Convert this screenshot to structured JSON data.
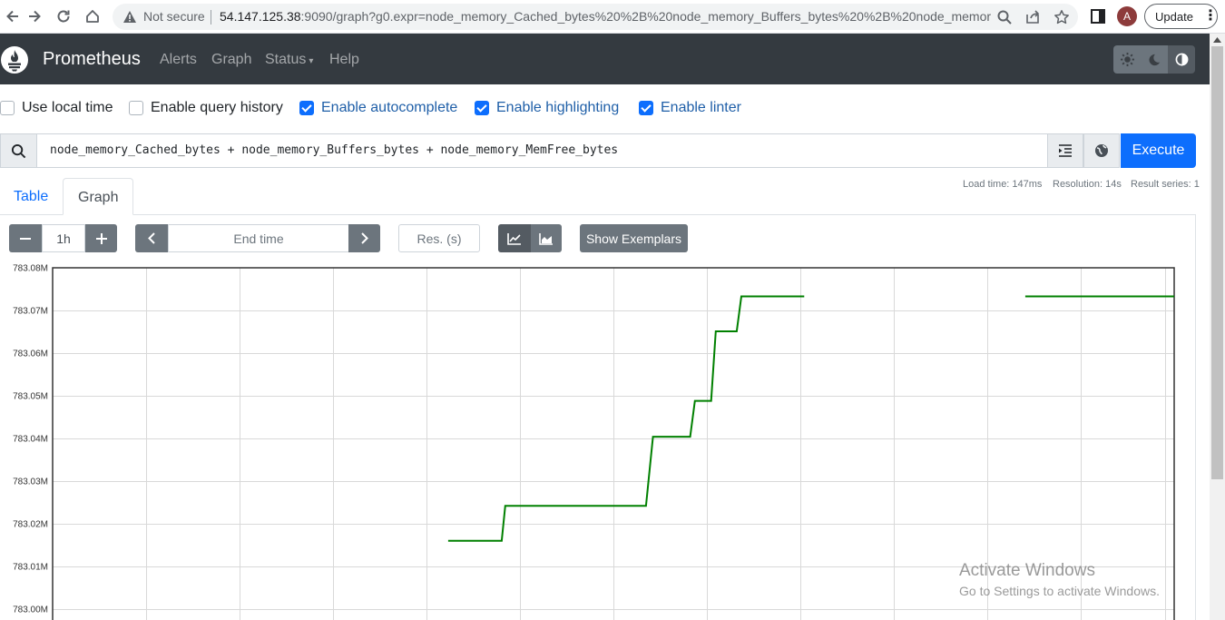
{
  "browser": {
    "security_label": "Not secure",
    "url_host": "54.147.125.38",
    "url_rest": ":9090/graph?g0.expr=node_memory_Cached_bytes%20%2B%20node_memory_Buffers_bytes%20%2B%20node_memory_...",
    "avatar_initial": "A",
    "update_label": "Update"
  },
  "navbar": {
    "brand": "Prometheus",
    "links": [
      "Alerts",
      "Graph",
      "Status",
      "Help"
    ],
    "status_caret": "▾",
    "bg_color": "#343a40"
  },
  "options": [
    {
      "label": "Use local time",
      "checked": false
    },
    {
      "label": "Enable query history",
      "checked": false
    },
    {
      "label": "Enable autocomplete",
      "checked": true
    },
    {
      "label": "Enable highlighting",
      "checked": true
    },
    {
      "label": "Enable linter",
      "checked": true
    }
  ],
  "query": {
    "expression": "node_memory_Cached_bytes + node_memory_Buffers_bytes + node_memory_MemFree_bytes",
    "execute_label": "Execute",
    "accent_color": "#0d6efd"
  },
  "stats": {
    "load_time": "Load time: 147ms",
    "resolution": "Resolution: 14s",
    "result_series": "Result series: 1"
  },
  "tabs": {
    "table": "Table",
    "graph": "Graph",
    "active": "Graph"
  },
  "controls": {
    "minus": "−",
    "range": "1h",
    "plus": "+",
    "end_time_placeholder": "End time",
    "resolution_placeholder": "Res. (s)",
    "exemplars_label": "Show Exemplars",
    "line_mode_selected": true
  },
  "chart_data": {
    "type": "line",
    "y_unit_note": "values in bytes",
    "ylim": [
      783000000,
      783080000
    ],
    "ytick_labels": [
      "783.08M",
      "783.07M",
      "783.06M",
      "783.05M",
      "783.04M",
      "783.03M",
      "783.02M",
      "783.01M",
      "783.00M"
    ],
    "ytick_values": [
      783080000,
      783070000,
      783060000,
      783050000,
      783040000,
      783030000,
      783020000,
      783010000,
      783000000
    ],
    "grid": true,
    "series": [
      {
        "color": "#008000",
        "segments": [
          [
            [
              0.0,
              783016000
            ],
            [
              0.23,
              783016000
            ],
            [
              0.245,
              783024200
            ],
            [
              0.85,
              783024200
            ],
            [
              0.88,
              783040400
            ],
            [
              1.04,
              783040400
            ],
            [
              1.06,
              783048800
            ],
            [
              1.13,
              783048800
            ],
            [
              1.15,
              783065100
            ],
            [
              1.24,
              783065100
            ],
            [
              1.26,
              783073300
            ],
            [
              1.53,
              783073300
            ]
          ],
          [
            [
              2.48,
              783073300
            ],
            [
              3.12,
              783073300
            ]
          ]
        ]
      }
    ],
    "x_range": [
      -1.7,
      3.12
    ]
  },
  "watermark": {
    "title": "Activate Windows",
    "subtitle": "Go to Settings to activate Windows."
  }
}
